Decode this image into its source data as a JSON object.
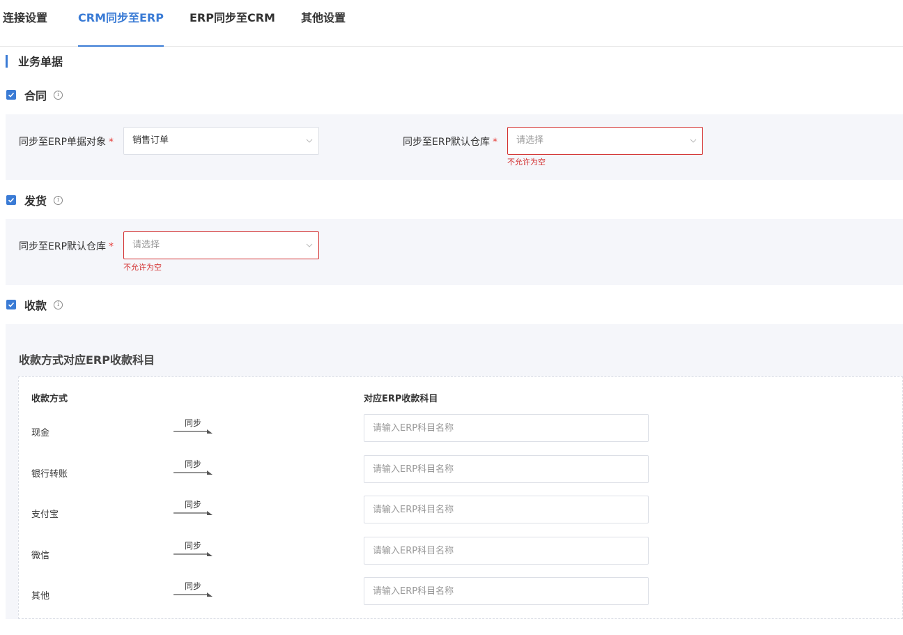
{
  "tabs": [
    {
      "label": "连接设置"
    },
    {
      "label": "CRM同步至ERP"
    },
    {
      "label": "ERP同步至CRM"
    },
    {
      "label": "其他设置"
    }
  ],
  "section_title": "业务单据",
  "contract": {
    "label": "合同",
    "fields": {
      "object_label": "同步至ERP单据对象",
      "object_value": "销售订单",
      "warehouse_label": "同步至ERP默认仓库",
      "warehouse_placeholder": "请选择",
      "warehouse_error": "不允许为空"
    }
  },
  "delivery": {
    "label": "发货",
    "fields": {
      "warehouse_label": "同步至ERP默认仓库",
      "warehouse_placeholder": "请选择",
      "warehouse_error": "不允许为空"
    }
  },
  "payment": {
    "label": "收款",
    "sub_title": "收款方式对应ERP收款科目",
    "col_method": "收款方式",
    "col_account": "对应ERP收款科目",
    "sync_label": "同步",
    "input_placeholder": "请输入ERP科目名称",
    "rows": [
      {
        "name": "现金"
      },
      {
        "name": "银行转账"
      },
      {
        "name": "支付宝"
      },
      {
        "name": "微信"
      },
      {
        "name": "其他"
      }
    ]
  },
  "colors": {
    "accent": "#3a7bd5",
    "error": "#d32f2f",
    "panel_bg": "#f5f6fa"
  }
}
